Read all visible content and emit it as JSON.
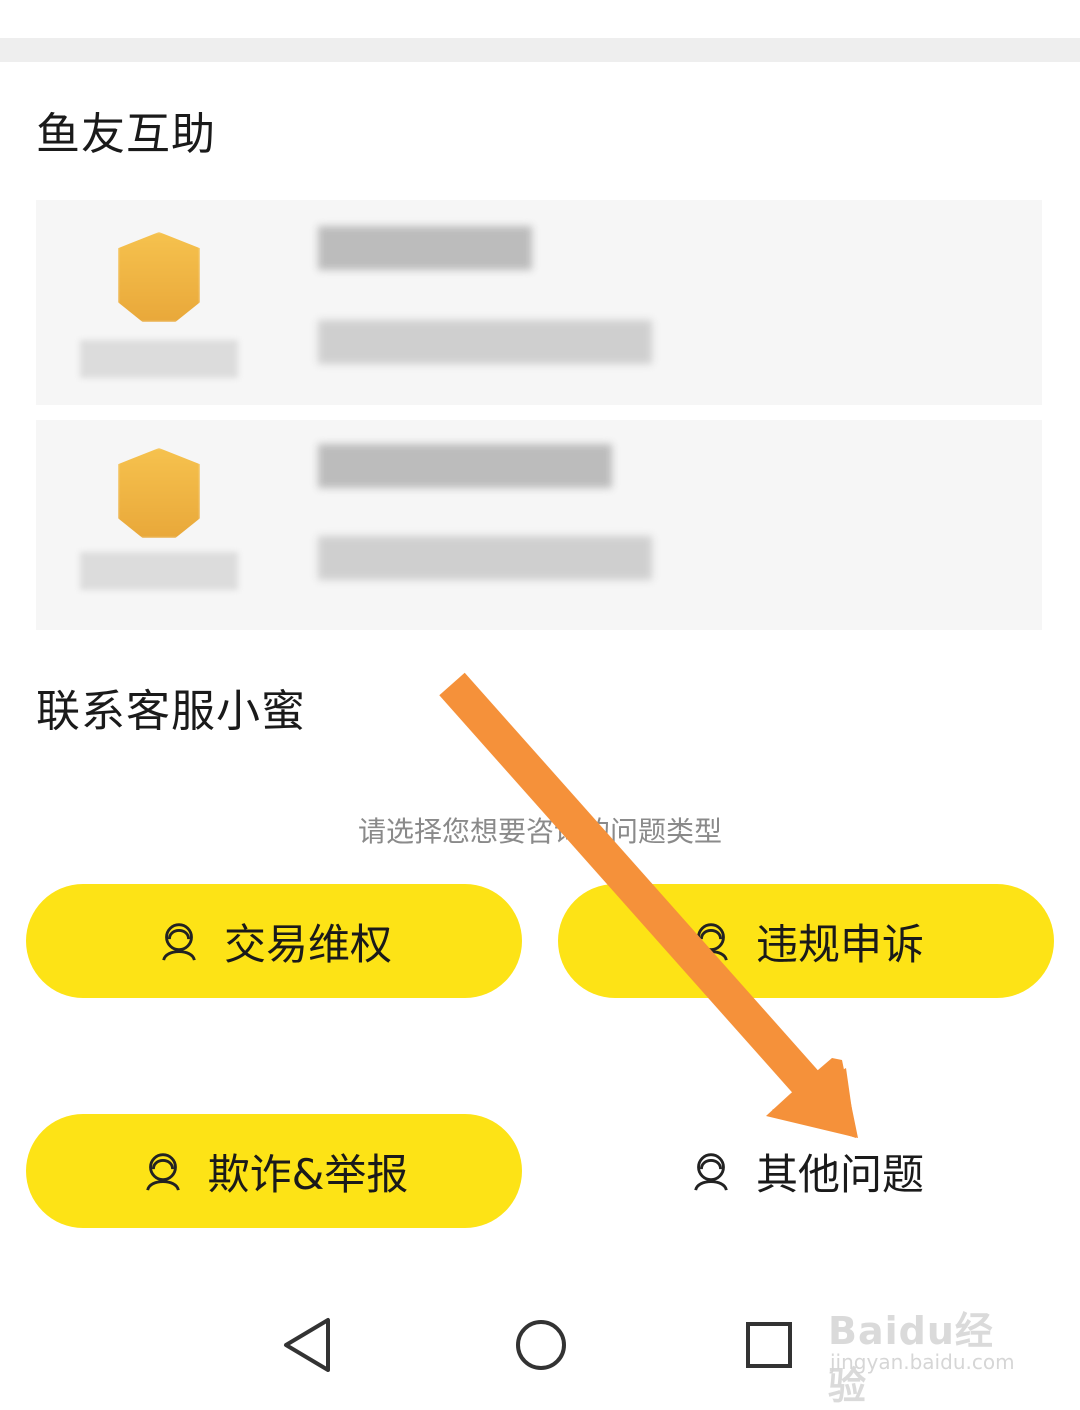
{
  "sections": {
    "mutual_help_title": "鱼友互助",
    "contact_title": "联系客服小蜜"
  },
  "hint": "请选择您想要咨询的问题类型",
  "buttons": {
    "trade": "交易维权",
    "violation": "违规申诉",
    "fraud": "欺诈&举报",
    "other": "其他问题"
  },
  "icons": {
    "agent": "customer-service-icon",
    "nav_back": "triangle-back-icon",
    "nav_home": "circle-home-icon",
    "nav_recent": "square-recent-icon"
  },
  "colors": {
    "accent_yellow": "#fde316",
    "arrow_orange": "#f5913a",
    "avatar_gold": "#f0b444"
  },
  "watermark": {
    "logo": "Baidu经验",
    "url": "jingyan.baidu.com"
  }
}
